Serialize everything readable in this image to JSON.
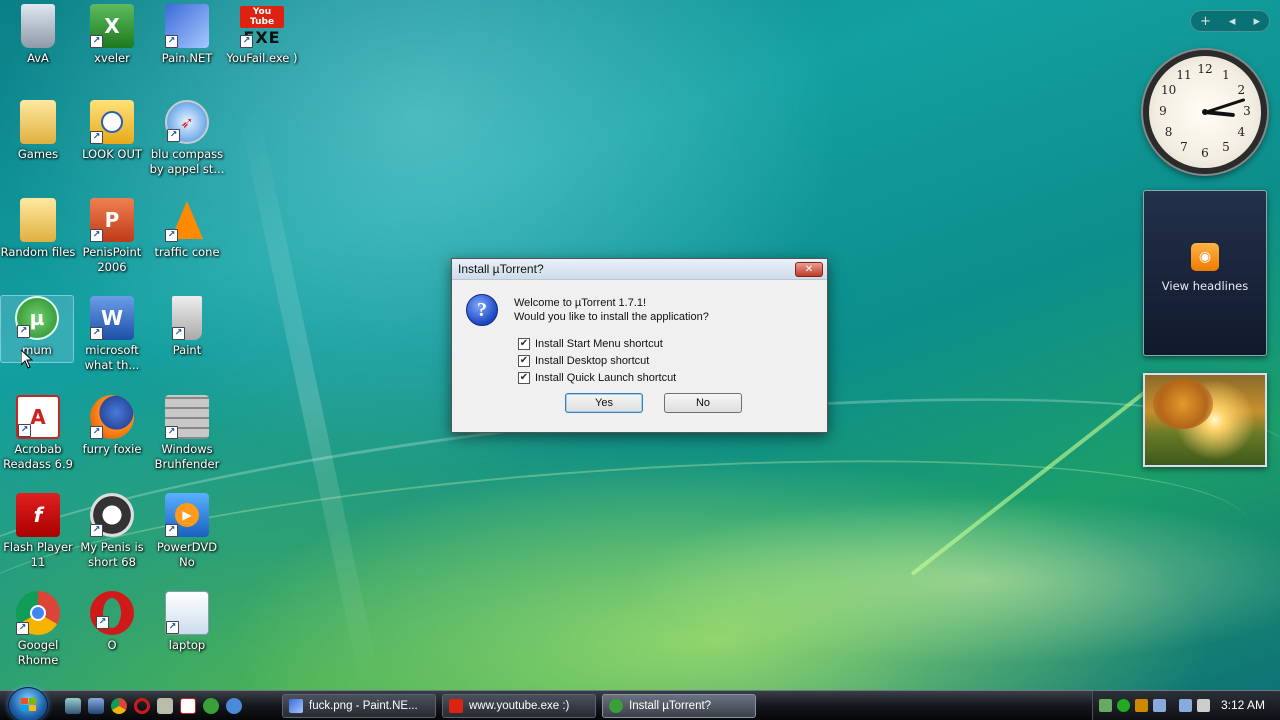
{
  "desktop": {
    "icons": [
      {
        "label": "AvA"
      },
      {
        "label": "xveler"
      },
      {
        "label": "Pain.NET"
      },
      {
        "label": "YouFail.exe )"
      },
      {
        "label": "Games"
      },
      {
        "label": "LOOK OUT"
      },
      {
        "label": "blu compass by appel st..."
      },
      {
        "label": "Random files"
      },
      {
        "label": "PenisPoint 2006"
      },
      {
        "label": "traffic cone"
      },
      {
        "label": "mum"
      },
      {
        "label": "microsoft what th..."
      },
      {
        "label": "Paint"
      },
      {
        "label": "Acrobab Readass 6.9"
      },
      {
        "label": "furry foxie"
      },
      {
        "label": "Windows Bruhfender"
      },
      {
        "label": "Flash Player 11"
      },
      {
        "label": "My Penis is short 68"
      },
      {
        "label": "PowerDVD No"
      },
      {
        "label": "Googel Rhome"
      },
      {
        "label": "O"
      },
      {
        "label": "laptop"
      }
    ],
    "youtube_logo": "You Tube",
    "exe_text": "EXE"
  },
  "gadgets": {
    "controls": {
      "add": "+",
      "prev": "◂",
      "next": "▸"
    },
    "clock": {
      "numbers": [
        "12",
        "1",
        "2",
        "3",
        "4",
        "5",
        "6",
        "7",
        "8",
        "9",
        "10",
        "11"
      ],
      "hour": 3,
      "minute": 12
    },
    "feed": {
      "label": "View headlines"
    }
  },
  "dialog": {
    "title": "Install µTorrent?",
    "close": "✕",
    "icon": "?",
    "message_line1": "Welcome to µTorrent 1.7.1!",
    "message_line2": "Would you like to install the application?",
    "options": [
      {
        "label": "Install Start Menu shortcut",
        "checked": true
      },
      {
        "label": "Install Desktop shortcut",
        "checked": true
      },
      {
        "label": "Install Quick Launch shortcut",
        "checked": true
      }
    ],
    "yes_label": "Yes",
    "no_label": "No"
  },
  "taskbar": {
    "tasks": [
      {
        "label": "fuck.png - Paint.NE..."
      },
      {
        "label": "www.youtube.exe :)"
      },
      {
        "label": "Install µTorrent?"
      }
    ],
    "time": "3:12 AM"
  },
  "colors": {
    "accent": "#1b5fa8",
    "utorrent_green": "#3aa03a"
  }
}
